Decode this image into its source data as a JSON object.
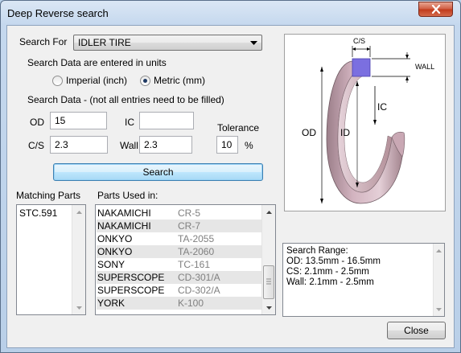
{
  "window": {
    "title": "Deep Reverse search"
  },
  "search_for": {
    "label": "Search For",
    "selected": "IDLER TIRE"
  },
  "units": {
    "label": "Search Data are entered in units",
    "options": [
      {
        "label": "Imperial (inch)",
        "checked": false
      },
      {
        "label": "Metric (mm)",
        "checked": true
      }
    ]
  },
  "search_data": {
    "label": "Search Data - (not all entries need to be filled)",
    "od_label": "OD",
    "od_value": "15",
    "ic_label": "IC",
    "ic_value": "",
    "cs_label": "C/S",
    "cs_value": "2.3",
    "wall_label": "Wall",
    "wall_value": "2.3",
    "tolerance_label": "Tolerance",
    "tolerance_value": "10",
    "percent_label": "%"
  },
  "search_button": "Search",
  "matching_parts": {
    "label": "Matching Parts",
    "items": [
      "STC.591"
    ]
  },
  "parts_used_in": {
    "label": "Parts Used in:",
    "rows": [
      {
        "maker": "NAKAMICHI",
        "model": "CR-5"
      },
      {
        "maker": "NAKAMICHI",
        "model": "CR-7"
      },
      {
        "maker": "ONKYO",
        "model": "TA-2055"
      },
      {
        "maker": "ONKYO",
        "model": "TA-2060"
      },
      {
        "maker": "SONY",
        "model": "TC-161"
      },
      {
        "maker": "SUPERSCOPE",
        "model": "CD-301/A"
      },
      {
        "maker": "SUPERSCOPE",
        "model": "CD-302/A"
      },
      {
        "maker": "YORK",
        "model": "K-100"
      }
    ]
  },
  "diagram": {
    "cs_label": "C/S",
    "wall_label": "WALL",
    "ic_label": "IC",
    "od_label": "OD",
    "id_label": "ID"
  },
  "search_range": {
    "lines": [
      "Search Range:",
      "OD: 13.5mm - 16.5mm",
      "CS: 2.1mm - 2.5mm",
      "Wall: 2.1mm - 2.5mm"
    ]
  },
  "close_button": "Close",
  "colors": {
    "title_close": "#c0391b",
    "ring_body": "#c9a8b4",
    "cross_section": "#7b6fe0",
    "focus_button": "#a7d9f5"
  }
}
